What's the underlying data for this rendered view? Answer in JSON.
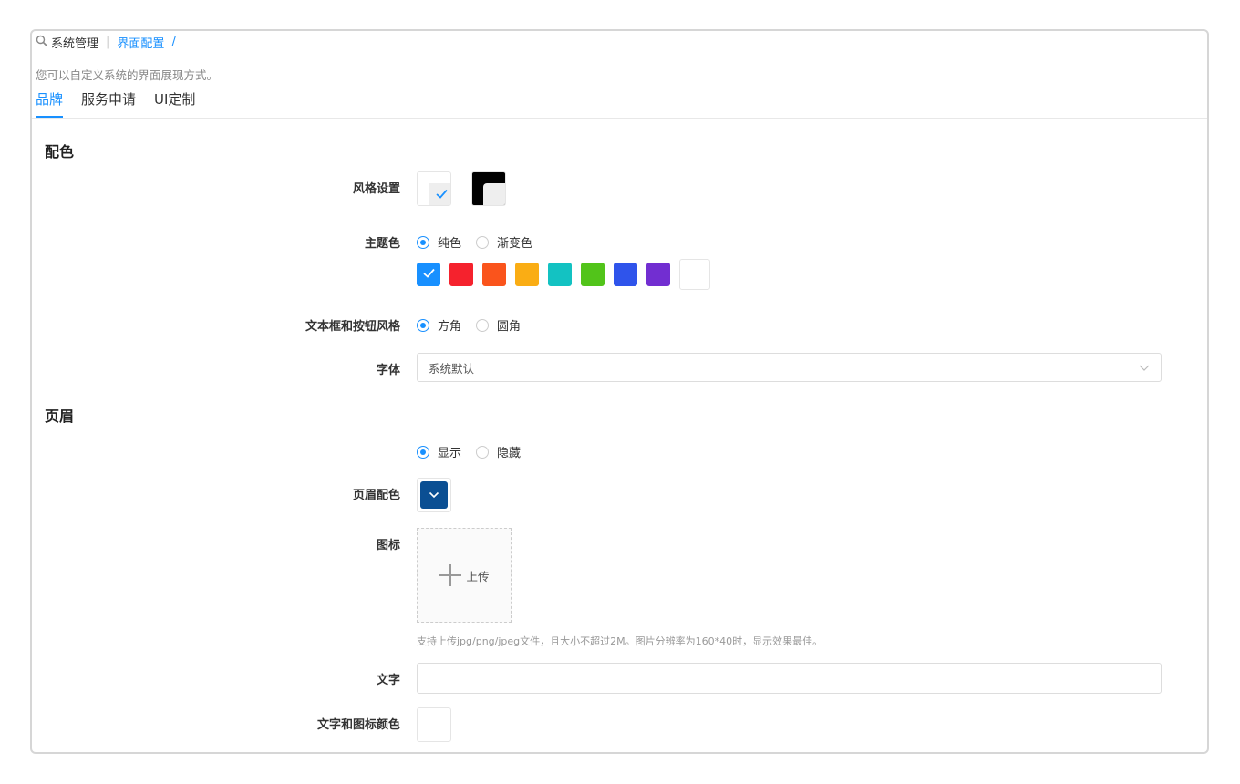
{
  "breadcrumb": {
    "root": "系统管理",
    "current": "界面配置",
    "separator": "/"
  },
  "description": "您可以自定义系统的界面展现方式。",
  "tabs": [
    {
      "label": "品牌",
      "active": true
    },
    {
      "label": "服务申请",
      "active": false
    },
    {
      "label": "UI定制",
      "active": false
    }
  ],
  "color_section": {
    "title": "配色",
    "style_label": "风格设置",
    "theme_label": "主题色",
    "theme_options": {
      "solid": "纯色",
      "gradient": "渐变色"
    },
    "theme_selected": "solid",
    "theme_colors": [
      "#1890ff",
      "#f5222d",
      "#fa541c",
      "#faad14",
      "#13c2c2",
      "#52c41a",
      "#2f54eb",
      "#722ed1"
    ],
    "selected_color": "#1890ff",
    "input_style_label": "文本框和按钮风格",
    "input_style_options": {
      "square": "方角",
      "round": "圆角"
    },
    "input_style_selected": "square",
    "font_label": "字体",
    "font_value": "系统默认"
  },
  "header_section": {
    "title": "页眉",
    "visibility_options": {
      "show": "显示",
      "hide": "隐藏"
    },
    "visibility_selected": "show",
    "header_color_label": "页眉配色",
    "header_color": "#0b4f93",
    "icon_label": "图标",
    "upload_label": "上传",
    "upload_hint": "支持上传jpg/png/jpeg文件，且大小不超过2M。图片分辨率为160*40时，显示效果最佳。",
    "text_label": "文字",
    "text_value": "",
    "text_icon_color_label": "文字和图标颜色"
  }
}
